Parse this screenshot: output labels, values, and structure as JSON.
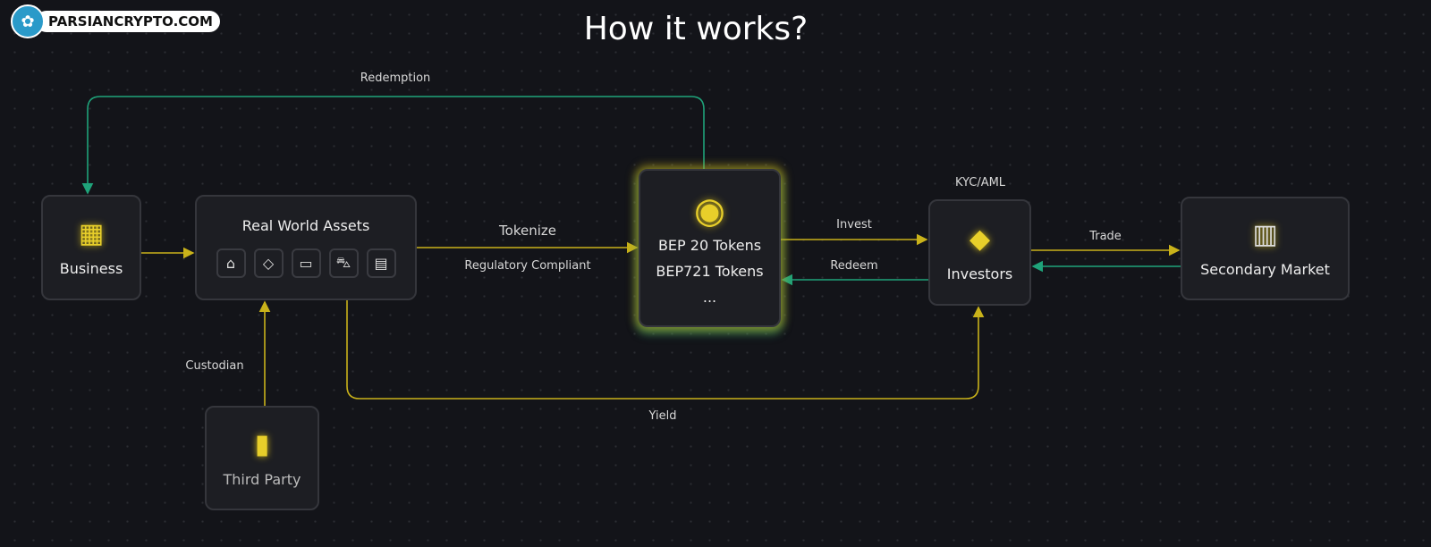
{
  "logo": {
    "text": "PARSIANCRYPTO.COM",
    "icon": "tree-icon"
  },
  "title": "How it works?",
  "colors": {
    "background": "#131419",
    "yellow": "#c9b21a",
    "green": "#1fa37a"
  },
  "nodes": {
    "business": {
      "label": "Business",
      "icon": "building-icon"
    },
    "rwa": {
      "label": "Real World Assets",
      "icons": [
        "house-icon",
        "diamond-icon",
        "ticket-icon",
        "car-icon",
        "document-icon"
      ]
    },
    "tokens": {
      "line1": "BEP 20 Tokens",
      "line2": "BEP721 Tokens",
      "line3": "...",
      "icon": "bnb-coin-icon"
    },
    "investors": {
      "label": "Investors",
      "icon": "investor-icon"
    },
    "secondary": {
      "label": "Secondary Market",
      "icon": "market-icon"
    },
    "third_party": {
      "label": "Third Party",
      "icon": "vault-icon"
    }
  },
  "edges": {
    "redemption": "Redemption",
    "tokenize": "Tokenize",
    "regulatory": "Regulatory Compliant",
    "invest": "Invest",
    "redeem": "Redeem",
    "kyc": "KYC/AML",
    "trade": "Trade",
    "custodian": "Custodian",
    "yield": "Yield"
  }
}
